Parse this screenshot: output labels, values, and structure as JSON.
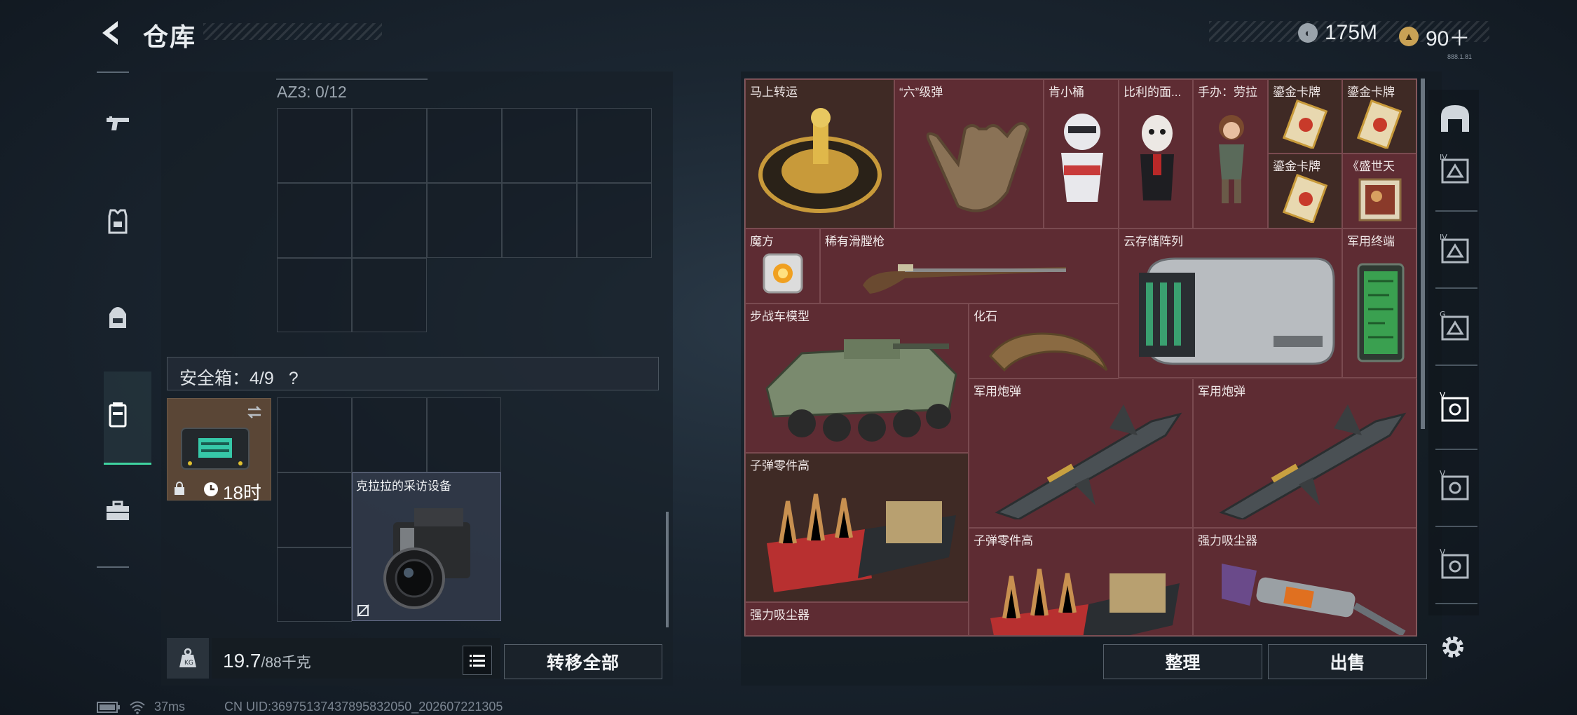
{
  "header": {
    "title": "仓库",
    "currency_1": {
      "icon": "coin-silver-icon",
      "value": "175M"
    },
    "currency_2": {
      "icon": "coin-gold-icon",
      "value": "90＋"
    },
    "version_text": "888.1.81"
  },
  "left_nav": {
    "items": [
      {
        "name": "weapons",
        "icon": "pistol-icon",
        "active": false
      },
      {
        "name": "armor",
        "icon": "vest-icon",
        "active": false
      },
      {
        "name": "backpack",
        "icon": "backpack-icon",
        "active": false
      },
      {
        "name": "safebox",
        "icon": "safebox-icon",
        "active": true
      },
      {
        "name": "toolbox",
        "icon": "toolbox-icon",
        "active": false
      }
    ]
  },
  "container": {
    "az3_label": "AZ3: 0/12",
    "safebox_label": "安全箱：4/9",
    "help": "?",
    "safebox_timer": "18时",
    "camera_item_label": "克拉拉的采访设备"
  },
  "bottom_left": {
    "weight_current": "19.7",
    "weight_capacity": "/88千克",
    "transfer_all": "转移全部"
  },
  "storage_items": [
    {
      "label": "马上转运"
    },
    {
      "label": "“六”级弹"
    },
    {
      "label": "肯小桶"
    },
    {
      "label": "比利的面..."
    },
    {
      "label": "手办：劳拉"
    },
    {
      "label": "鎏金卡牌"
    },
    {
      "label": "鎏金卡牌"
    },
    {
      "label": "鎏金卡牌"
    },
    {
      "label": "《盛世天"
    },
    {
      "label": "魔方"
    },
    {
      "label": "稀有滑膛枪"
    },
    {
      "label": "云存储阵列"
    },
    {
      "label": "军用终端"
    },
    {
      "label": "步战车模型"
    },
    {
      "label": "化石"
    },
    {
      "label": "军用炮弹"
    },
    {
      "label": "军用炮弹"
    },
    {
      "label": "子弹零件高"
    },
    {
      "label": "子弹零件高"
    },
    {
      "label": "强力吸尘器"
    },
    {
      "label": "强力吸尘器"
    }
  ],
  "bottom_right": {
    "sort": "整理",
    "sell": "出售"
  },
  "status": {
    "ping": "37ms",
    "uid": "CN UID:3697513743789583​2050_202607221305"
  },
  "colors": {
    "accent_green": "#3fd3a0",
    "storage_bg": "#5a2a30",
    "safebox_bg": "#5a4636"
  }
}
